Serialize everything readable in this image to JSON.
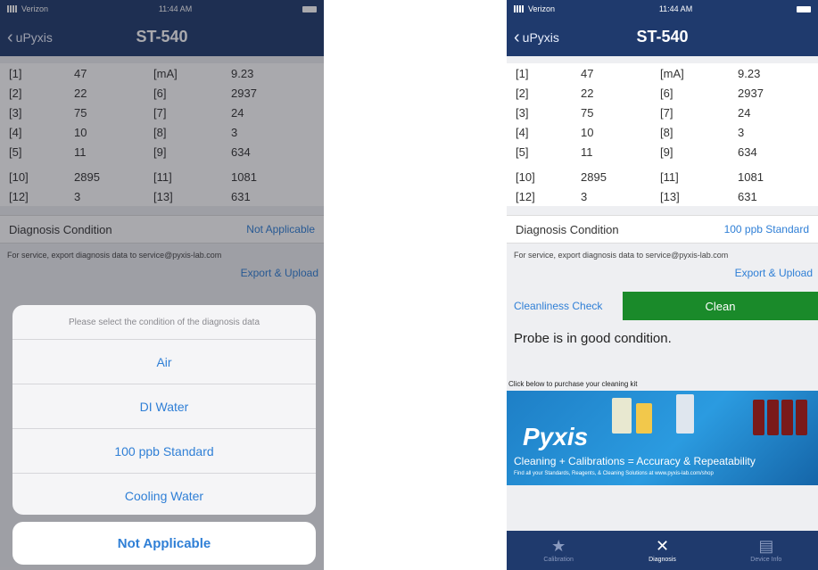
{
  "left": {
    "status": {
      "carrier": "Verizon",
      "time": "11:44 AM"
    },
    "nav": {
      "back": "uPyxis",
      "title": "ST-540"
    },
    "rows": [
      [
        "[1]",
        "47",
        "[mA]",
        "9.23"
      ],
      [
        "[2]",
        "22",
        "[6]",
        "2937"
      ],
      [
        "[3]",
        "75",
        "[7]",
        "24"
      ],
      [
        "[4]",
        "10",
        "[8]",
        "3"
      ],
      [
        "[5]",
        "11",
        "[9]",
        "634"
      ],
      [
        "[10]",
        "2895",
        "[11]",
        "1081"
      ],
      [
        "[12]",
        "3",
        "[13]",
        "631"
      ]
    ],
    "diag_label": "Diagnosis Condition",
    "diag_value": "Not Applicable",
    "service_text": "For service, export diagnosis data to service@pyxis-lab.com",
    "export_label": "Export & Upload",
    "sheet": {
      "header": "Please select the condition of the diagnosis data",
      "options": [
        "Air",
        "DI Water",
        "100 ppb Standard",
        "Cooling Water"
      ],
      "cancel": "Not Applicable"
    }
  },
  "right": {
    "status": {
      "carrier": "Verizon",
      "time": "11:44 AM"
    },
    "nav": {
      "back": "uPyxis",
      "title": "ST-540"
    },
    "rows": [
      [
        "[1]",
        "47",
        "[mA]",
        "9.23"
      ],
      [
        "[2]",
        "22",
        "[6]",
        "2937"
      ],
      [
        "[3]",
        "75",
        "[7]",
        "24"
      ],
      [
        "[4]",
        "10",
        "[8]",
        "3"
      ],
      [
        "[5]",
        "11",
        "[9]",
        "634"
      ],
      [
        "[10]",
        "2895",
        "[11]",
        "1081"
      ],
      [
        "[12]",
        "3",
        "[13]",
        "631"
      ]
    ],
    "diag_label": "Diagnosis Condition",
    "diag_value": "100 ppb Standard",
    "service_text": "For service, export diagnosis data to service@pyxis-lab.com",
    "export_label": "Export & Upload",
    "cleanliness_label": "Cleanliness Check",
    "cleanliness_value": "Clean",
    "condition_text": "Probe is in good condition.",
    "kit_caption": "Click below to purchase your cleaning kit",
    "banner": {
      "logo": "Pyxis",
      "tagline": "Cleaning + Calibrations = Accuracy & Repeatability",
      "subline": "Find all your Standards, Reagents, & Cleaning Solutions at www.pyxis-lab.com/shop"
    },
    "tabs": [
      {
        "label": "Calibration",
        "icon": "star-icon"
      },
      {
        "label": "Diagnosis",
        "icon": "tools-icon"
      },
      {
        "label": "Device Info",
        "icon": "info-doc-icon"
      }
    ],
    "colors": {
      "nav": "#1f3a6d",
      "accent": "#2f7fd6",
      "clean": "#1a8a2a"
    }
  }
}
